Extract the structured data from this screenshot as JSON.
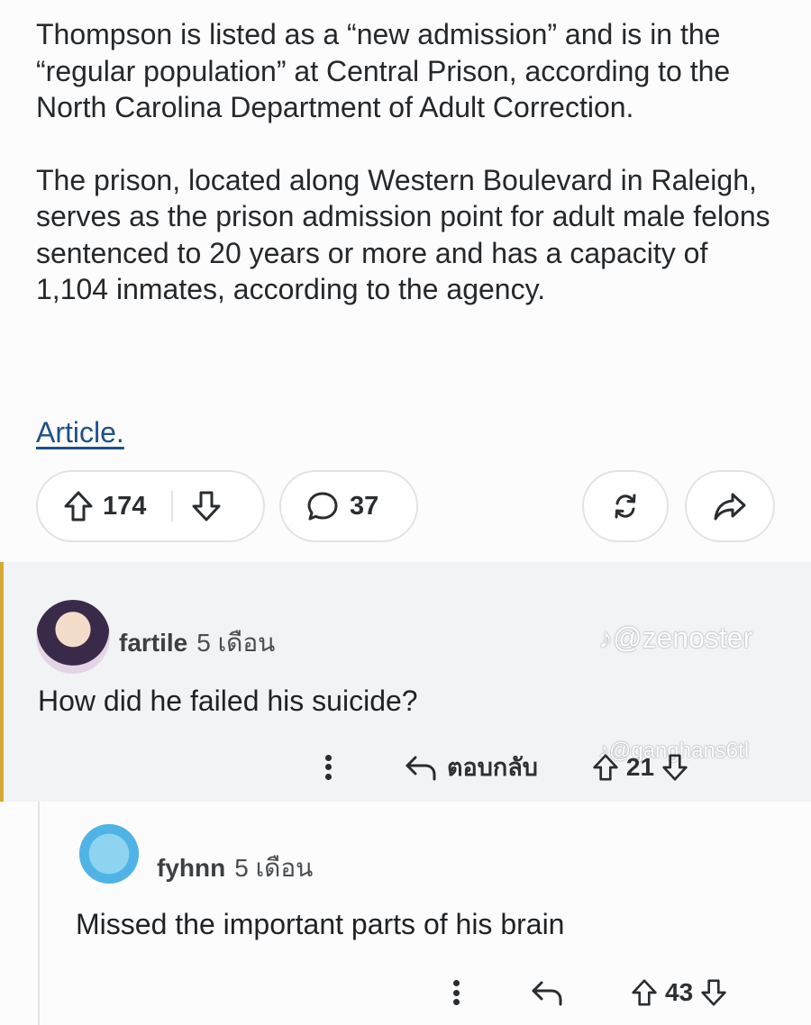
{
  "post": {
    "paragraph_1": "Thompson is listed as a “new admission” and is in the “regular population” at Central Prison, according to the North Carolina Department of Adult Correction.",
    "paragraph_2": "The prison, located along Western Boulevard in Raleigh, serves as the prison admission point for adult male felons sentenced to 20 years or more and has a capacity of 1,104 inmates, according to the agency.",
    "link_text": "Article."
  },
  "action_bar": {
    "upvote_count": "174",
    "comment_count": "37"
  },
  "comments": [
    {
      "username": "fartile",
      "time": "5 เดือน",
      "text": "How did he failed his suicide?",
      "reply_label": "ตอบกลับ",
      "score": "21"
    },
    {
      "username": "fyhnn",
      "time": "5 เดือน",
      "text": "Missed the important parts of his brain",
      "score": "43"
    }
  ],
  "watermarks": {
    "first": "@zenoster",
    "second": "@ganghans6tl"
  },
  "colors": {
    "link": "#1f4f8a",
    "highlight_border": "#d4a93a",
    "comment_bg": "#f1f3f5"
  }
}
